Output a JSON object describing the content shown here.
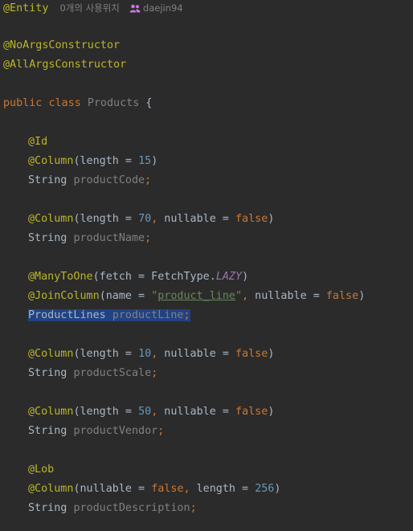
{
  "hint": {
    "annotation": "@Entity",
    "usages": "0개의 사용위치",
    "author": "daejin94",
    "author_icon": "people-icon"
  },
  "annotations": {
    "no_args": "@NoArgsConstructor",
    "all_args": "@AllArgsConstructor"
  },
  "class_decl": {
    "kw_public": "public",
    "kw_class": "class",
    "name": "Products",
    "brace": "{"
  },
  "fields": {
    "code": {
      "id_ann": "@Id",
      "col_ann": "@Column",
      "open": "(length = ",
      "length": "15",
      "close": ")",
      "type": "String",
      "name": "productCode",
      "semi": ";"
    },
    "name": {
      "col_ann": "@Column",
      "open": "(length = ",
      "length": "70",
      "comma": ",",
      "nullable_key": " nullable = ",
      "nullable_val": "false",
      "close": ")",
      "type": "String",
      "name": "productName",
      "semi": ";"
    },
    "line": {
      "m2o_ann": "@ManyToOne",
      "m2o_args": "(fetch = FetchType.",
      "fetch": "LAZY",
      "m2o_close": ")",
      "join_ann": "@JoinColumn",
      "join_open": "(name = ",
      "q1": "\"",
      "join_name": "product_line",
      "q2": "\"",
      "comma": ",",
      "nullable_key": " nullable = ",
      "nullable_val": "false",
      "close": ")",
      "type": "ProductLines",
      "name": "productLine",
      "semi": ";"
    },
    "scale": {
      "col_ann": "@Column",
      "open": "(length = ",
      "length": "10",
      "comma": ",",
      "nullable_key": " nullable = ",
      "nullable_val": "false",
      "close": ")",
      "type": "String",
      "name": "productScale",
      "semi": ";"
    },
    "vendor": {
      "col_ann": "@Column",
      "open": "(length = ",
      "length": "50",
      "comma": ",",
      "nullable_key": " nullable = ",
      "nullable_val": "false",
      "close": ")",
      "type": "String",
      "name": "productVendor",
      "semi": ";"
    },
    "description": {
      "lob_ann": "@Lob",
      "col_ann": "@Column",
      "open": "(nullable = ",
      "nullable_val": "false",
      "comma": ",",
      "length_key": " length = ",
      "length": "256",
      "close": ")",
      "type": "String",
      "name": "productDescription",
      "semi": ";"
    }
  },
  "colors": {
    "background": "#2b2b2b",
    "keyword": "#cc7832",
    "annotation": "#bbb529",
    "number": "#6897bb",
    "string": "#6a8759",
    "field": "#808080",
    "selection": "#214283"
  }
}
